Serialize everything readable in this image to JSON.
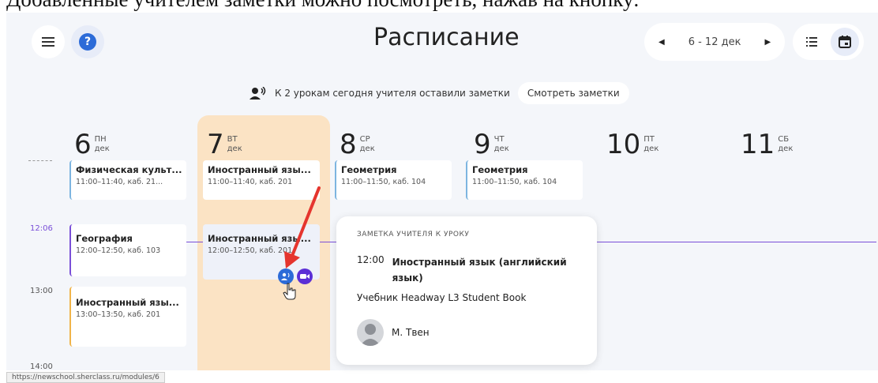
{
  "caption": "Добавленные учителем заметки можно посмотреть, нажав на кнопку:",
  "header": {
    "title": "Расписание",
    "week_range": "6 - 12 дек"
  },
  "notice": {
    "text": "К 2 урокам сегодня учителя оставили заметки",
    "button": "Смотреть заметки"
  },
  "days": [
    {
      "num": "6",
      "dow": "ПН",
      "month": "дек"
    },
    {
      "num": "7",
      "dow": "ВТ",
      "month": "дек"
    },
    {
      "num": "8",
      "dow": "СР",
      "month": "дек"
    },
    {
      "num": "9",
      "dow": "ЧТ",
      "month": "дек"
    },
    {
      "num": "10",
      "dow": "ПТ",
      "month": "дек"
    },
    {
      "num": "11",
      "dow": "СБ",
      "month": "дек"
    }
  ],
  "times": {
    "current": "12:06",
    "t1300": "13:00",
    "t1400": "14:00"
  },
  "lessons": {
    "mon1": {
      "name": "Физическая культ...",
      "info": "11:00–11:40, каб. 21..."
    },
    "mon2": {
      "name": "География",
      "info": "12:00–12:50, каб. 103"
    },
    "mon3": {
      "name": "Иностранный язы...",
      "info": "13:00–13:50, каб. 201"
    },
    "tue1": {
      "name": "Иностранный язы...",
      "info": "11:00–11:40, каб. 201"
    },
    "tue2": {
      "name": "Иностранный язы...",
      "info": "12:00–12:50, каб. 201"
    },
    "wed1": {
      "name": "Геометрия",
      "info": "11:00–11:50, каб. 104"
    },
    "thu1": {
      "name": "Геометрия",
      "info": "11:00–11:50, каб. 104"
    }
  },
  "popup": {
    "label": "ЗАМЕТКА УЧИТЕЛЯ К УРОКУ",
    "time": "12:00",
    "lesson": "Иностранный язык (английский язык)",
    "text": "Учебник Headway L3 Student Book",
    "teacher": "М. Твен"
  },
  "status_url": "https://newschool.sherclass.ru/modules/6",
  "colors": {
    "accent_blue": "#2c6bd8",
    "today_column": "#fbe3c4",
    "now_line": "#7a4fd8",
    "arrow_red": "#e5352e",
    "video_badge": "#5b2fd6"
  }
}
